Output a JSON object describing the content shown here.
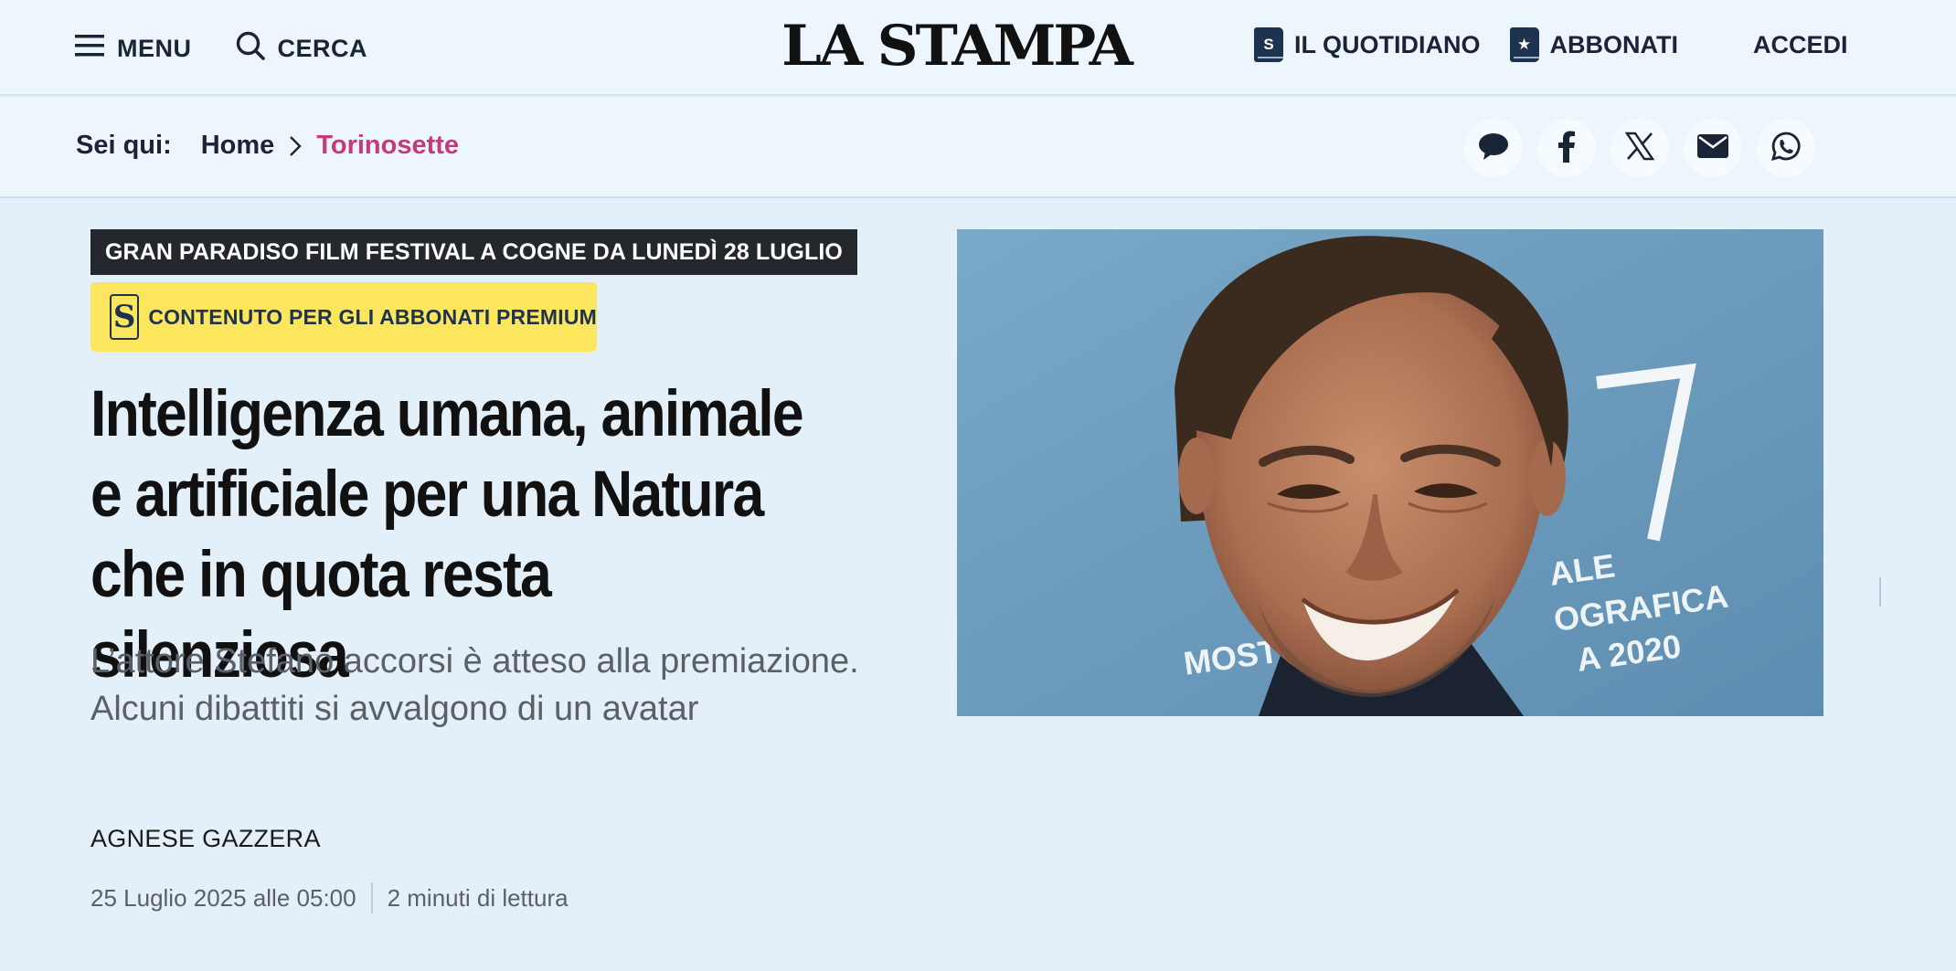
{
  "header": {
    "menu_label": "MENU",
    "search_label": "CERCA",
    "logo": "LA STAMPA",
    "quotidiano_label": "IL QUOTIDIANO",
    "abbonati_label": "ABBONATI",
    "accedi_label": "ACCEDI"
  },
  "breadcrumb": {
    "prefix": "Sei qui:",
    "items": [
      "Home",
      "Torinosette"
    ],
    "current_color": "#c63a7c"
  },
  "share_icons": [
    "comment-icon",
    "facebook-icon",
    "x-icon",
    "email-icon",
    "whatsapp-icon"
  ],
  "article": {
    "kicker": "GRAN PARADISO FILM FESTIVAL A COGNE DA LUNEDÌ 28 LUGLIO",
    "premium_badge": "S",
    "premium_label": "CONTENUTO PER GLI ABBONATI PREMIUM",
    "headline": "Intelligenza umana, animale e artificiale per una Natura che in quota resta silenziosa",
    "subtitle": "L’attore Stefano accorsi è atteso alla premiazione. Alcuni dibattiti si avvalgono di un avatar",
    "author": "AGNESE GAZZERA",
    "date": "25 Luglio 2025 alle 05:00",
    "reading_time": "2 minuti di lettura"
  },
  "photo": {
    "backdrop_text": [
      "MOST",
      "ALE",
      "OGRAFICA",
      "A 2020"
    ],
    "backdrop_numeral": "7"
  },
  "colors": {
    "header_bg": "#edf6fc",
    "page_bg": "#e3f0f9",
    "kicker_bg": "#24282d",
    "premium_bg": "#fce65d",
    "nav_text": "#1a2437"
  }
}
